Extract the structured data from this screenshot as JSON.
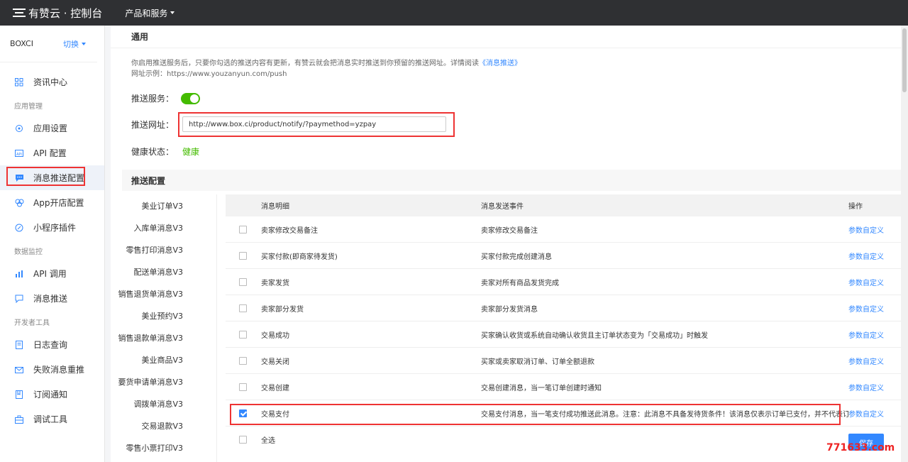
{
  "topbar": {
    "brand": "有赞云 · 控制台",
    "nav_products": "产品和服务"
  },
  "sidebar": {
    "shop_name": "BOXCI",
    "switch_label": "切换",
    "items": [
      {
        "label": "资讯中心",
        "icon": "grid-icon"
      },
      {
        "group": "应用管理"
      },
      {
        "label": "应用设置",
        "icon": "gear-icon"
      },
      {
        "label": "API 配置",
        "icon": "api-icon"
      },
      {
        "label": "消息推送配置",
        "icon": "message-icon",
        "active": true
      },
      {
        "label": "App开店配置",
        "icon": "app-icon"
      },
      {
        "label": "小程序插件",
        "icon": "miniprogram-icon"
      },
      {
        "group": "数据监控"
      },
      {
        "label": "API 调用",
        "icon": "bar-chart-icon"
      },
      {
        "label": "消息推送",
        "icon": "push-icon"
      },
      {
        "group": "开发者工具"
      },
      {
        "label": "日志查询",
        "icon": "log-icon"
      },
      {
        "label": "失败消息重推",
        "icon": "mail-icon"
      },
      {
        "label": "订阅通知",
        "icon": "bookmark-icon"
      },
      {
        "label": "调试工具",
        "icon": "toolbox-icon"
      }
    ]
  },
  "main": {
    "section_general": "通用",
    "desc_line1": "你启用推送服务后，只要你勾选的推送内容有更新，有赞云就会把消息实时推送到你预留的推送网址。详情阅读",
    "desc_link": "《消息推送》",
    "desc_line2": "网址示例：https://www.youzanyun.com/push",
    "push_service_label": "推送服务：",
    "push_url_label": "推送网址：",
    "push_url_value": "http://www.box.ci/product/notify/?paymethod=yzpay",
    "health_label": "健康状态：",
    "health_value": "健康",
    "section_push_config": "推送配置",
    "categories": [
      "美业订单V3",
      "入库单消息V3",
      "零售打印消息V3",
      "配送单消息V3",
      "销售退货单消息V3",
      "美业预约V3",
      "销售退款单消息V3",
      "美业商品V3",
      "要货申请单消息V3",
      "调拨单消息V3",
      "交易退款V3",
      "零售小票打印V3"
    ],
    "table": {
      "col_detail": "消息明细",
      "col_event": "消息发送事件",
      "col_op": "操作",
      "rows": [
        {
          "name": "卖家修改交易备注",
          "event": "卖家修改交易备注",
          "op": "参数自定义",
          "checked": false
        },
        {
          "name": "买家付款(即商家待发货)",
          "event": "买家付款完成创建消息",
          "op": "参数自定义",
          "checked": false
        },
        {
          "name": "卖家发货",
          "event": "卖家对所有商品发货完成",
          "op": "参数自定义",
          "checked": false
        },
        {
          "name": "卖家部分发货",
          "event": "卖家部分发货消息",
          "op": "参数自定义",
          "checked": false
        },
        {
          "name": "交易成功",
          "event": "买家确认收货或系统自动确认收货且主订单状态变为「交易成功」时触发",
          "op": "参数自定义",
          "checked": false
        },
        {
          "name": "交易关闭",
          "event": "买家或卖家取消订单、订单全额退款",
          "op": "参数自定义",
          "checked": false
        },
        {
          "name": "交易创建",
          "event": "交易创建消息，当一笔订单创建时通知",
          "op": "参数自定义",
          "checked": false
        },
        {
          "name": "交易支付",
          "event": "交易支付消息，当一笔支付成功推送此消息。注意：此消息不具备发待货条件！该消息仅表示订单已支付，并不代表订单待发货",
          "op": "参数自定义",
          "checked": true
        }
      ],
      "select_all": "全选"
    },
    "save_label": "保存"
  },
  "watermark": "771633.com",
  "colors": {
    "accent": "#3388ff",
    "toggle_on": "#44bb00",
    "highlight_box": "#ee3333"
  }
}
